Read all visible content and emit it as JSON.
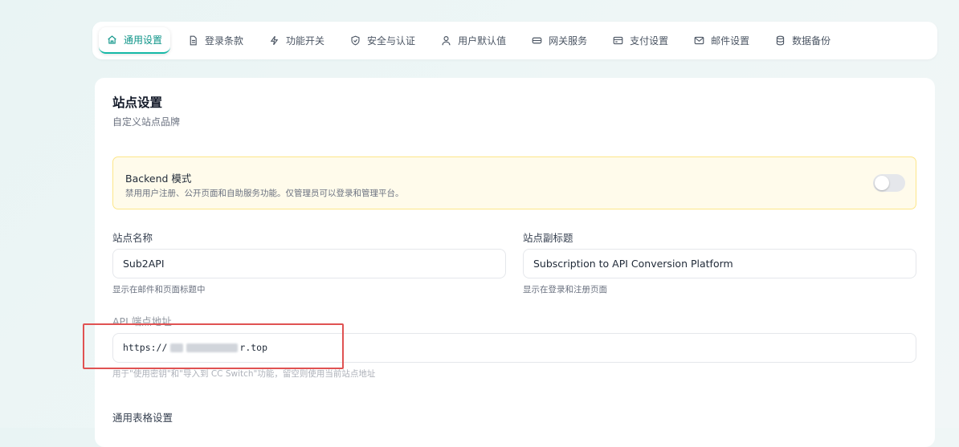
{
  "tabs": [
    {
      "label": "通用设置",
      "icon": "home-icon",
      "active": true
    },
    {
      "label": "登录条款",
      "icon": "document-icon",
      "active": false
    },
    {
      "label": "功能开关",
      "icon": "lightning-icon",
      "active": false
    },
    {
      "label": "安全与认证",
      "icon": "shield-check-icon",
      "active": false
    },
    {
      "label": "用户默认值",
      "icon": "user-icon",
      "active": false
    },
    {
      "label": "网关服务",
      "icon": "server-icon",
      "active": false
    },
    {
      "label": "支付设置",
      "icon": "credit-card-icon",
      "active": false
    },
    {
      "label": "邮件设置",
      "icon": "mail-icon",
      "active": false
    },
    {
      "label": "数据备份",
      "icon": "database-icon",
      "active": false
    }
  ],
  "site": {
    "title": "站点设置",
    "subtitle": "自定义站点品牌"
  },
  "backend_mode": {
    "title": "Backend 模式",
    "description": "禁用用户注册、公开页面和自助服务功能。仅管理员可以登录和管理平台。",
    "enabled": false
  },
  "fields": {
    "site_name": {
      "label": "站点名称",
      "value": "Sub2API",
      "hint": "显示在邮件和页面标题中"
    },
    "site_subtitle": {
      "label": "站点副标题",
      "value": "Subscription to API Conversion Platform",
      "hint": "显示在登录和注册页面"
    },
    "api_endpoint": {
      "label": "API 端点地址",
      "value_prefix": "https://",
      "value_suffix": "r.top",
      "hint": "用于\"使用密钥\"和\"导入到 CC Switch\"功能，留空则使用当前站点地址"
    }
  },
  "table_settings": {
    "title": "通用表格设置"
  },
  "colors": {
    "accent": "#0d9488",
    "highlight_box": "#e05252",
    "banner_bg": "#fffbeb"
  }
}
